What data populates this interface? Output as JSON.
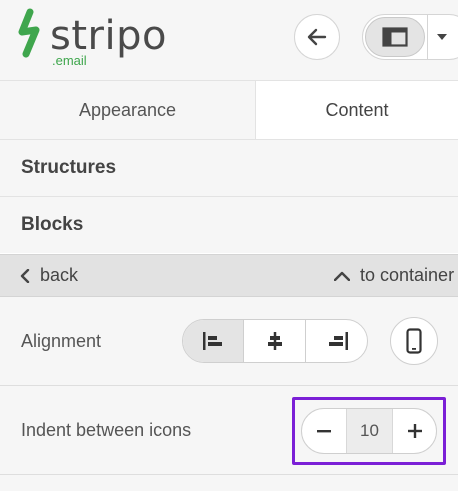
{
  "logo": {
    "word": "stripo",
    "sub": ".email"
  },
  "tabs": [
    {
      "label": "Appearance",
      "active": false
    },
    {
      "label": "Content",
      "active": true
    }
  ],
  "sections": {
    "structures": "Structures",
    "blocks": "Blocks"
  },
  "nav": {
    "back": "back",
    "container": "to container"
  },
  "settings": {
    "alignment_label": "Alignment",
    "alignment_selected": "left",
    "indent_label": "Indent between icons",
    "indent_value": "10"
  },
  "colors": {
    "brand_green": "#3fa64d",
    "highlight": "#7b1fd6"
  },
  "icons": [
    "back-arrow-icon",
    "panel-layout-icon",
    "caret-down-icon",
    "chevron-left-icon",
    "chevron-up-icon",
    "align-left-icon",
    "align-center-icon",
    "align-right-icon",
    "mobile-icon",
    "minus-icon",
    "plus-icon"
  ]
}
